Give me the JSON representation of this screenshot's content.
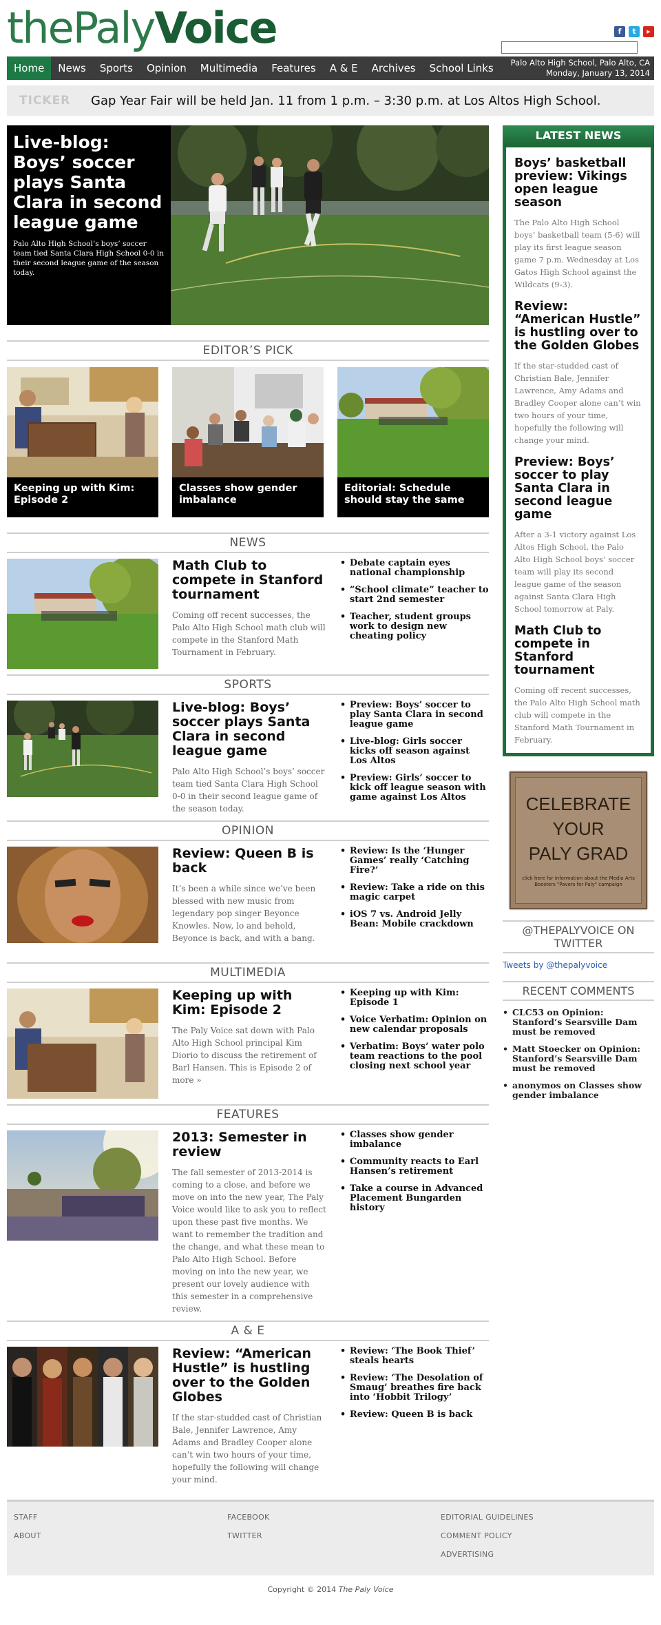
{
  "site": {
    "logo_the": "the",
    "logo_paly": "Paly",
    "logo_voice": "Voice",
    "location": "Palo Alto High School, Palo Alto, CA",
    "date": "Monday, January 13, 2014"
  },
  "nav": [
    "Home",
    "News",
    "Sports",
    "Opinion",
    "Multimedia",
    "Features",
    "A & E",
    "Archives",
    "School Links"
  ],
  "ticker": {
    "label": "TICKER",
    "text": "Gap Year Fair will be held Jan. 11 from 1 p.m. – 3:30 p.m. at Los Altos High School."
  },
  "hero": {
    "title": "Live-blog: Boys’ soccer plays Santa Clara in second league game",
    "summary": "Palo Alto High School’s boys’ soccer team tied Santa Clara High School 0-0 in their second league game of the season today."
  },
  "editors_pick": {
    "heading": "EDITOR’S PICK",
    "items": [
      "Keeping up with Kim: Episode 2",
      "Classes show gender imbalance",
      "Editorial: Schedule should stay the same"
    ]
  },
  "sections": {
    "news": {
      "heading": "NEWS",
      "title": "Math Club to compete in Stanford tournament",
      "summary": "Coming off recent successes, the Palo Alto High School math club will compete in the Stanford Math Tournament in February.",
      "links": [
        "Debate captain eyes national championship",
        "“School climate” teacher to start 2nd semester",
        "Teacher, student groups work to design new cheating policy"
      ]
    },
    "sports": {
      "heading": "SPORTS",
      "title": "Live-blog: Boys’ soccer plays Santa Clara in second league game",
      "summary": "Palo Alto High School’s boys’ soccer team tied Santa Clara High School 0-0 in their second league game of the season today.",
      "links": [
        "Preview: Boys’ soccer to play Santa Clara in second league game",
        "Live-blog: Girls soccer kicks off season against Los Altos",
        "Preview: Girls’ soccer to kick off league season with game against Los Altos"
      ]
    },
    "opinion": {
      "heading": "OPINION",
      "title": "Review: Queen B is back",
      "summary": "It’s been a while since we’ve been blessed with new music from legendary pop singer Beyonce Knowles. Now, lo and behold, Beyonce is back, and with a bang.",
      "links": [
        "Review: Is the ‘Hunger Games’ really ‘Catching Fire?’",
        "Review: Take a ride on this magic carpet",
        "iOS 7 vs. Android Jelly Bean: Mobile crackdown"
      ]
    },
    "multimedia": {
      "heading": "MULTIMEDIA",
      "title": "Keeping up with Kim: Episode 2",
      "summary": "The Paly Voice sat down with Palo Alto High School principal Kim Diorio to discuss the retirement of Barl Hansen. This is Episode 2 of more »",
      "links": [
        "Keeping up with Kim: Episode 1",
        "Voice Verbatim: Opinion on new calendar proposals",
        "Verbatim: Boys’ water polo team reactions to the pool closing next school year"
      ]
    },
    "features": {
      "heading": "FEATURES",
      "title": "2013: Semester in review",
      "summary": "The fall semester of 2013-2014 is coming to a close, and before we move on into the new year, The Paly Voice would like to ask you to reflect upon these past five months. We want to remember the tradition and the change, and what these mean to Palo Alto High School. Before moving on into the new year, we present our lovely audience with this semester in a comprehensive review.",
      "links": [
        "Classes show gender imbalance",
        "Community reacts to Earl Hansen’s retirement",
        "Take a course in Advanced Placement Bungarden history"
      ]
    },
    "ae": {
      "heading": "A & E",
      "title": "Review: “American Hustle” is hustling over to the Golden Globes",
      "summary": "If the star-studded cast of Christian Bale, Jennifer Lawrence, Amy Adams and Bradley Cooper alone can’t win two hours of your time, hopefully the following will change your mind.",
      "links": [
        "Review: ‘The Book Thief’ steals hearts",
        "Review: ‘The Desolation of Smaug’ breathes fire back into ‘Hobbit Trilogy’",
        "Review: Queen B is back"
      ]
    }
  },
  "latest_news": {
    "heading": "LATEST NEWS",
    "stories": [
      {
        "title": "Boys’ basketball preview: Vikings open league season",
        "summary": "The Palo Alto High School boys’ basketball team (5-6) will play its first league season game 7 p.m. Wednesday at Los Gatos High School against the Wildcats (9-3)."
      },
      {
        "title": "Review: “American Hustle” is hustling over to the Golden Globes",
        "summary": "If the star-studded cast of Christian Bale, Jennifer Lawrence, Amy Adams and Bradley Cooper alone can’t win two hours of your time, hopefully the following will change your mind."
      },
      {
        "title": "Preview: Boys’ soccer to play Santa Clara in second league game",
        "summary": "After a 3-1 victory against Los Altos High School, the Palo Alto High School boys’ soccer team will play its second league game of the season against Santa Clara High School tomorrow at Paly."
      },
      {
        "title": "Math Club to compete in Stanford tournament",
        "summary": "Coming off recent successes, the Palo Alto High School math club will compete in the Stanford Math Tournament in February."
      }
    ]
  },
  "ad": {
    "line1": "CELEBRATE",
    "line2": "YOUR",
    "line3": "PALY GRAD",
    "small": "click here for information about the Media Arts Boosters \"Pavers for Paly\" campaign"
  },
  "twitter": {
    "heading": "@THEPALYVOICE ON TWITTER",
    "link": "Tweets by @thepalyvoice"
  },
  "recent_comments": {
    "heading": "RECENT COMMENTS",
    "items": [
      "CLC53 on Opinion: Stanford’s Searsville Dam must be removed",
      "Matt Stoecker on Opinion: Stanford’s Searsville Dam must be removed",
      "anonymos on Classes show gender imbalance"
    ]
  },
  "footer": {
    "col1": [
      "STAFF",
      "ABOUT"
    ],
    "col2": [
      "FACEBOOK",
      "TWITTER"
    ],
    "col3": [
      "EDITORIAL GUIDELINES",
      "COMMENT POLICY",
      "ADVERTISING"
    ],
    "copyright_prefix": "Copyright © 2014 ",
    "copyright_name": "The Paly Voice"
  },
  "colors": {
    "brand_green": "#1d6e3c",
    "nav_bg": "#3c3c3c",
    "nav_active": "#1d7a45"
  }
}
